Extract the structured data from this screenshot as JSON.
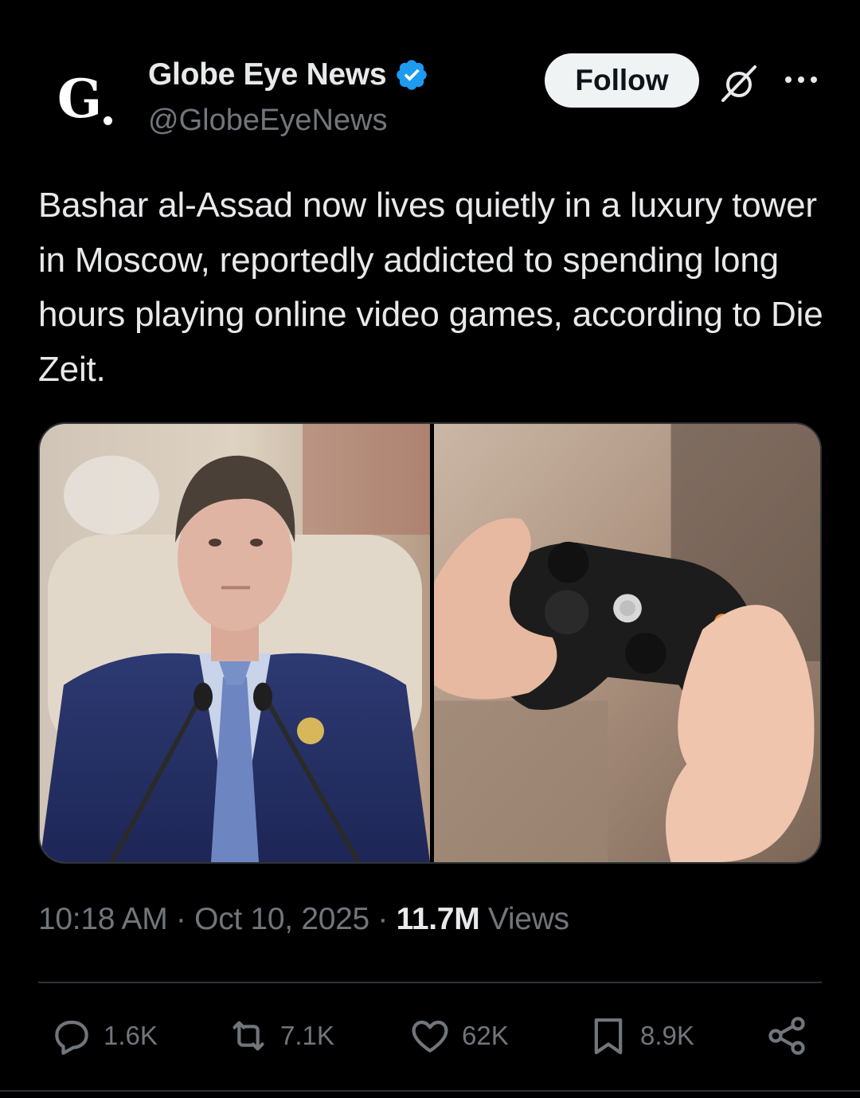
{
  "author": {
    "display_name": "Globe Eye News",
    "handle": "@GlobeEyeNews",
    "avatar_letter": "G",
    "verified": true,
    "verified_color": "#1d9bf0"
  },
  "header": {
    "follow_label": "Follow",
    "grok_icon": "grok-icon",
    "more_icon": "more-dots-icon"
  },
  "tweet": {
    "text": "Bashar al-Assad now lives quietly in a luxury tower in Moscow, reportedly addicted to spending long hours playing online video games, according to Die Zeit."
  },
  "media": {
    "left_image": "man-in-suit-at-podium",
    "right_image": "hands-holding-game-controller"
  },
  "meta": {
    "time": "10:18 AM",
    "separator1": " · ",
    "date": "Oct 10, 2025",
    "separator2": " · ",
    "views_count": "11.7M",
    "views_label": " Views"
  },
  "actions": {
    "replies": "1.6K",
    "reposts": "7.1K",
    "likes": "62K",
    "bookmarks": "8.9K"
  },
  "colors": {
    "background": "#000000",
    "text_primary": "#e7e9ea",
    "text_secondary": "#71767b",
    "border": "#2f3336",
    "follow_bg": "#eff3f4"
  }
}
